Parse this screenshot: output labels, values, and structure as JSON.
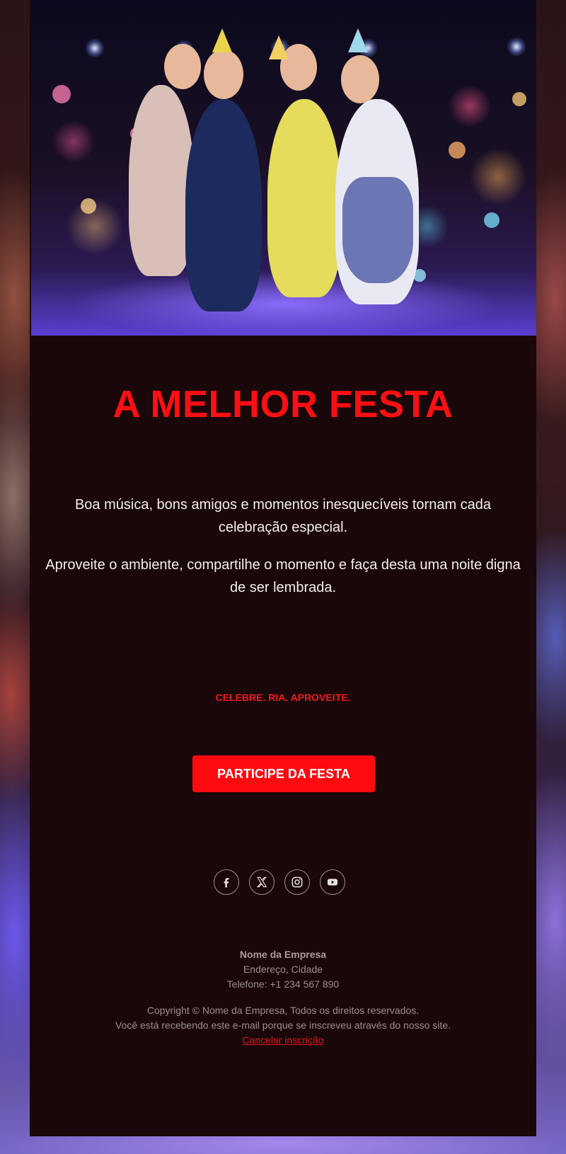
{
  "hero": {
    "image_alt": "Grupo de amigos com chapéus de festa brindando com taças em uma festa iluminada"
  },
  "headline": "A MELHOR FESTA",
  "body": {
    "paragraph_1": "Boa música, bons amigos e momentos inesquecíveis tornam cada celebração especial.",
    "paragraph_2": "Aproveite o ambiente, compartilhe o momento e faça desta uma noite digna de ser lembrada."
  },
  "tagline": "CELEBRE. RIA. APROVEITE.",
  "cta": {
    "label": "PARTICIPE DA FESTA",
    "color": "#ff0a0f"
  },
  "social": {
    "icons": [
      "facebook-icon",
      "x-icon",
      "instagram-icon",
      "youtube-icon"
    ]
  },
  "footer": {
    "company": "Nome da Empresa",
    "address": "Endereço, Cidade",
    "phone": "Telefone: +1 234 567 890",
    "copyright": "Copyright © Nome da Empresa, Todos os direitos reservados.",
    "notice": "Você está recebendo este e-mail porque se inscreveu através do nosso site.",
    "unsubscribe": "Cancelar inscrição"
  },
  "colors": {
    "accent": "#ff0f14",
    "background": "#1a0709"
  }
}
